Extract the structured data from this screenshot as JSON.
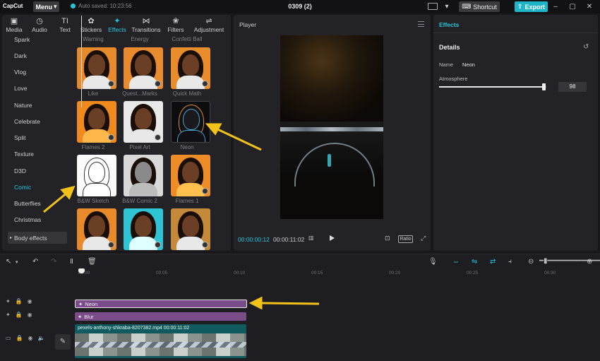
{
  "titlebar": {
    "logo": "CapCut",
    "menu_label": "Menu",
    "autosave": "Auto saved: 10:23:56",
    "project_title": "0309 (2)",
    "shortcut_label": "Shortcut",
    "export_label": "Export"
  },
  "toolbar": [
    {
      "label": "Media",
      "icon": "▣"
    },
    {
      "label": "Audio",
      "icon": "◷"
    },
    {
      "label": "Text",
      "icon": "TI"
    },
    {
      "label": "Stickers",
      "icon": "✿"
    },
    {
      "label": "Effects",
      "icon": "✦"
    },
    {
      "label": "Transitions",
      "icon": "⋈"
    },
    {
      "label": "Filters",
      "icon": "❀"
    },
    {
      "label": "Adjustment",
      "icon": "⇌"
    }
  ],
  "categories": [
    "Spark",
    "Dark",
    "Vlog",
    "Love",
    "Nature",
    "Celebrate",
    "Split",
    "Texture",
    "D3D",
    "Comic",
    "Butterflies",
    "Christmas"
  ],
  "active_category": "Comic",
  "body_effects_label": "Body effects",
  "effects_grid": {
    "top_labels": [
      "Warning",
      "Energy",
      "Confetti Ball"
    ],
    "rows": [
      [
        "Like",
        "Quest...Marks",
        "Quick Math"
      ],
      [
        "Flames 2",
        "Pixel Art",
        "Neon"
      ],
      [
        "B&W Sketch",
        "B&W Comic 2",
        "Flames 1"
      ]
    ]
  },
  "player": {
    "title": "Player",
    "current_time": "00:00:00:12",
    "total_time": "00:00:11:02",
    "ratio_label": "Ratio"
  },
  "right_panel": {
    "tab": "Effects",
    "details": "Details",
    "name_label": "Name",
    "name_value": "Neon",
    "atmosphere_label": "Atmosphere",
    "atmosphere_value": "98",
    "atmosphere_fraction": 0.98
  },
  "timeline": {
    "ticks": [
      "00:00",
      "00:05",
      "00:10",
      "00:15",
      "00:20",
      "00:25",
      "00:30"
    ],
    "clips": {
      "neon": "Neon",
      "blur": "Blur",
      "video": "pexels-anthony-shkraba-8207382.mp4  00:00:11:02"
    }
  },
  "colors": {
    "accent": "#25c6d9",
    "effect_clip": "#7a4d8a",
    "video_clip": "#0f5a5e",
    "arrow": "#f2c21b"
  }
}
